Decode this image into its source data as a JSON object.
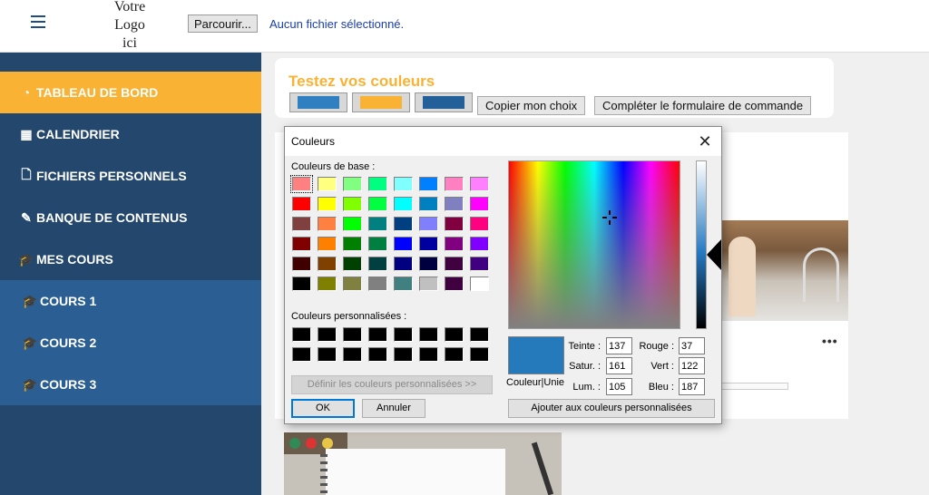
{
  "topbar": {
    "logo_line1": "Votre",
    "logo_line2": "Logo",
    "logo_line3": "ici",
    "browse_label": "Parcourir...",
    "file_status": "Aucun fichier sélectionné."
  },
  "sidebar": {
    "items": [
      {
        "label": "TABLEAU DE BORD",
        "icon": "dashboard-icon",
        "active": true
      },
      {
        "label": "CALENDRIER",
        "icon": "calendar-icon"
      },
      {
        "label": "FICHIERS PERSONNELS",
        "icon": "file-icon"
      },
      {
        "label": "BANQUE DE CONTENUS",
        "icon": "brush-icon"
      },
      {
        "label": "MES COURS",
        "icon": "graduation-cap-icon"
      },
      {
        "label": "COURS 1",
        "icon": "graduation-cap-icon"
      },
      {
        "label": "COURS 2",
        "icon": "graduation-cap-icon"
      },
      {
        "label": "COURS 3",
        "icon": "graduation-cap-icon"
      }
    ]
  },
  "colors": {
    "sidebar_bg": "#23476d",
    "sidebar_active": "#f9b233",
    "sidebar_sub": "#2b5f93",
    "swatch1": "#2f7fc1",
    "swatch2": "#f9b233",
    "swatch3": "#23609a",
    "current_color": "#257abb"
  },
  "tester": {
    "title": "Testez vos couleurs",
    "copy_label": "Copier mon choix",
    "complete_label": "Compléter le formulaire de commande"
  },
  "dialog": {
    "title": "Couleurs",
    "basic_label": "Couleurs de base :",
    "custom_label": "Couleurs personnalisées :",
    "define_label": "Définir les couleurs personnalisées >>",
    "ok_label": "OK",
    "cancel_label": "Annuler",
    "add_label": "Ajouter aux couleurs personnalisées",
    "preview_label": "Couleur|Unie",
    "hue_label": "Teinte :",
    "sat_label": "Satur. :",
    "lum_label": "Lum. :",
    "red_label": "Rouge :",
    "green_label": "Vert :",
    "blue_label": "Bleu :",
    "hue": "137",
    "sat": "161",
    "lum": "105",
    "red": "37",
    "green": "122",
    "blue": "187",
    "basic_colors": [
      "#ff8080",
      "#ffff80",
      "#80ff80",
      "#00ff80",
      "#80ffff",
      "#0080ff",
      "#ff80c0",
      "#ff80ff",
      "#ff0000",
      "#ffff00",
      "#80ff00",
      "#00ff40",
      "#00ffff",
      "#0080c0",
      "#8080c0",
      "#ff00ff",
      "#804040",
      "#ff8040",
      "#00ff00",
      "#008080",
      "#004080",
      "#8080ff",
      "#800040",
      "#ff0080",
      "#800000",
      "#ff8000",
      "#008000",
      "#008040",
      "#0000ff",
      "#0000a0",
      "#800080",
      "#8000ff",
      "#400000",
      "#804000",
      "#004000",
      "#004040",
      "#000080",
      "#000040",
      "#400040",
      "#400080",
      "#000000",
      "#808000",
      "#808040",
      "#808080",
      "#408080",
      "#c0c0c0",
      "#400040",
      "#ffffff"
    ],
    "custom_colors": [
      "#000000",
      "#000000",
      "#000000",
      "#000000",
      "#000000",
      "#000000",
      "#000000",
      "#000000",
      "#000000",
      "#000000",
      "#000000",
      "#000000",
      "#000000",
      "#000000",
      "#000000",
      "#000000"
    ]
  },
  "course_card": {
    "more_label": "•••"
  }
}
